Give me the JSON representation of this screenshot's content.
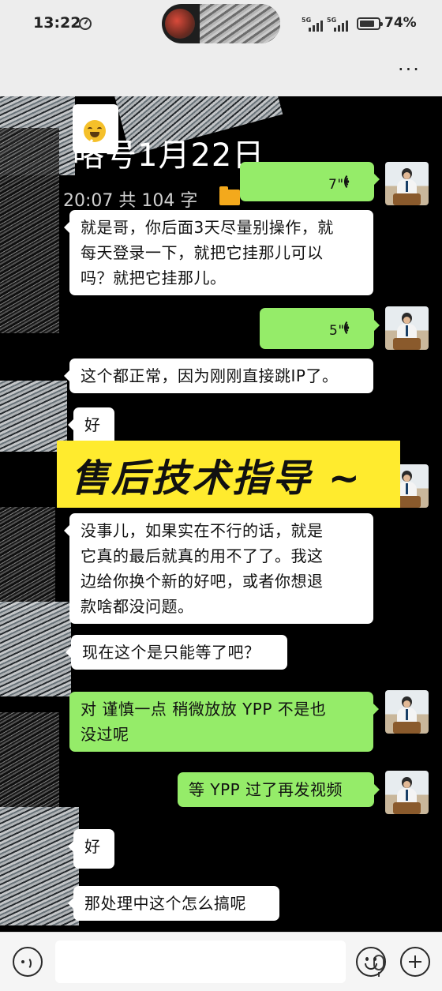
{
  "status_bar": {
    "time": "13:22",
    "signal_1": "5G",
    "signal_2": "5G",
    "battery": "74%"
  },
  "nav": {
    "more_label": "···"
  },
  "file": {
    "title": "咯号1月22日",
    "meta": "20:07 共 104 字"
  },
  "banner": {
    "text": "售后技术指导 ~"
  },
  "messages": [
    {
      "side": "out",
      "type": "voice",
      "duration": "7\""
    },
    {
      "side": "in",
      "type": "text",
      "lines": [
        "就是哥，你后面3天尽量别操作，就",
        "每天登录一下，就把它挂那儿可以",
        "吗？就把它挂那儿。"
      ]
    },
    {
      "side": "out",
      "type": "voice",
      "duration": "5\""
    },
    {
      "side": "in",
      "type": "text",
      "lines": [
        "这个都正常，因为刚刚直接跳IP了。"
      ]
    },
    {
      "side": "in",
      "type": "text",
      "lines": [
        "好"
      ]
    },
    {
      "side": "in",
      "type": "text",
      "lines": [
        "没事儿，如果实在不行的话，就是",
        "它真的最后就真的用不了了。我这",
        "边给你换个新的好吧，或者你想退",
        "款啥都没问题。"
      ]
    },
    {
      "side": "in",
      "type": "text",
      "lines": [
        "现在这个是只能等了吧？"
      ]
    },
    {
      "side": "out",
      "type": "text",
      "lines": [
        "对 谨慎一点 稍微放放 YPP 不是也",
        "没过呢"
      ]
    },
    {
      "side": "out",
      "type": "text",
      "lines": [
        "等 YPP 过了再发视频"
      ]
    },
    {
      "side": "in",
      "type": "text",
      "lines": [
        "好"
      ]
    },
    {
      "side": "in",
      "type": "text",
      "lines": [
        "那处理中这个怎么搞呢"
      ]
    }
  ],
  "icons": {
    "clock": "clock-icon",
    "mic": "microphone-icon",
    "emoji": "smiley-icon",
    "plus": "plus-icon",
    "voice_toggle": "voice-icon",
    "folder": "folder-icon"
  },
  "colors": {
    "outgoing_bubble": "#95ec69",
    "incoming_bubble": "#ffffff",
    "chat_background": "#000000",
    "banner": "#ffeb2e",
    "folder": "#f3a91c"
  }
}
